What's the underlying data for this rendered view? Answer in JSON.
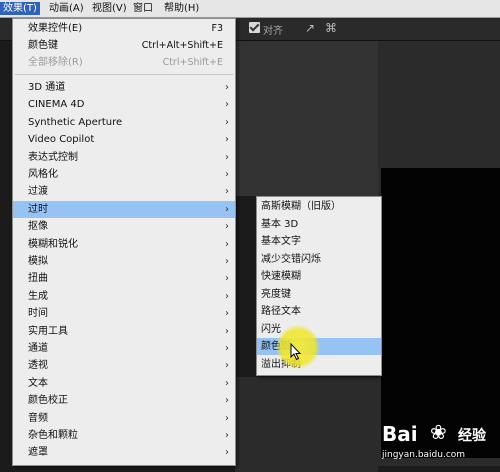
{
  "menubar": {
    "items": [
      {
        "label": "效果(T)",
        "open": true
      },
      {
        "label": "动画(A)"
      },
      {
        "label": "视图(V)"
      },
      {
        "label": "窗口"
      },
      {
        "label": "帮助(H)"
      }
    ]
  },
  "toolbar": {
    "snap_label": "对齐",
    "snap_checked": true
  },
  "effects_menu": {
    "top_items": [
      {
        "label": "效果控件(E)",
        "shortcut": "F3",
        "enabled": true
      },
      {
        "label": "颜色键",
        "shortcut": "Ctrl+Alt+Shift+E",
        "enabled": true
      },
      {
        "label": "全部移除(R)",
        "shortcut": "Ctrl+Shift+E",
        "enabled": false
      }
    ],
    "categories": [
      {
        "label": "3D 通道"
      },
      {
        "label": "CINEMA 4D"
      },
      {
        "label": "Synthetic Aperture"
      },
      {
        "label": "Video Copilot"
      },
      {
        "label": "表达式控制"
      },
      {
        "label": "风格化"
      },
      {
        "label": "过渡"
      },
      {
        "label": "过时",
        "highlighted": true
      },
      {
        "label": "抠像"
      },
      {
        "label": "模糊和锐化"
      },
      {
        "label": "模拟"
      },
      {
        "label": "扭曲"
      },
      {
        "label": "生成"
      },
      {
        "label": "时间"
      },
      {
        "label": "实用工具"
      },
      {
        "label": "通道"
      },
      {
        "label": "透视"
      },
      {
        "label": "文本"
      },
      {
        "label": "颜色校正"
      },
      {
        "label": "音频"
      },
      {
        "label": "杂色和颗粒"
      },
      {
        "label": "遮罩"
      }
    ]
  },
  "obsolete_submenu": {
    "items": [
      {
        "label": "高斯模糊（旧版）"
      },
      {
        "label": "基本 3D"
      },
      {
        "label": "基本文字"
      },
      {
        "label": "减少交错闪烁"
      },
      {
        "label": "快速模糊"
      },
      {
        "label": "亮度键"
      },
      {
        "label": "路径文本"
      },
      {
        "label": "闪光"
      },
      {
        "label": "颜色键",
        "highlighted": true
      },
      {
        "label": "溢出抑制"
      }
    ]
  },
  "watermark": {
    "brand": "Bai",
    "brand_cn": "经验",
    "url": "jingyan.baidu.com"
  },
  "colors": {
    "menu_bg": "#ededed",
    "highlight": "#97c3f4",
    "active_menu": "#2f63b9",
    "cursor_spot": "#f2e62a"
  }
}
